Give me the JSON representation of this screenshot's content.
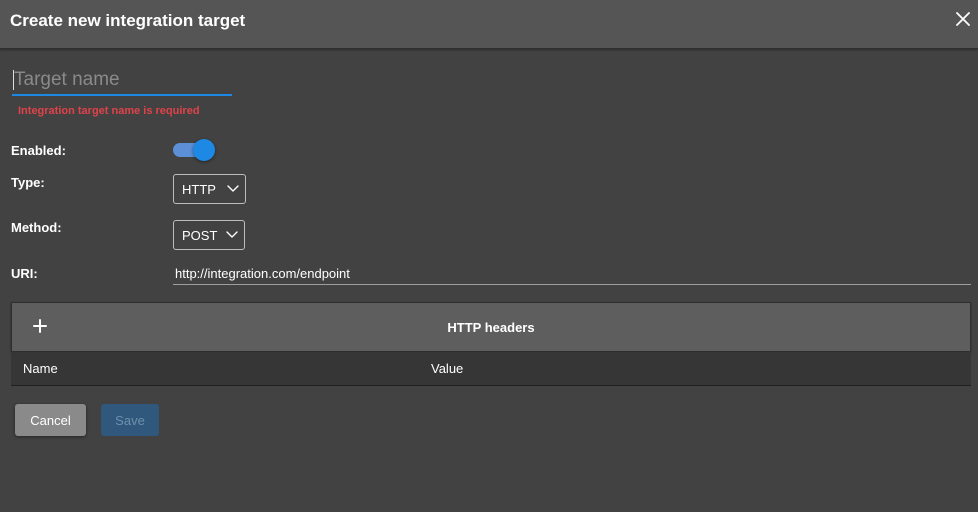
{
  "dialog": {
    "title": "Create new integration target"
  },
  "form": {
    "target_name": {
      "placeholder": "Target name",
      "value": "",
      "error": "Integration target name is required"
    },
    "enabled": {
      "label": "Enabled:",
      "on": true
    },
    "type": {
      "label": "Type:",
      "value": "HTTP"
    },
    "method": {
      "label": "Method:",
      "value": "POST"
    },
    "uri": {
      "label": "URI:",
      "value": "http://integration.com/endpoint"
    }
  },
  "headers": {
    "title": "HTTP headers",
    "columns": [
      "Name",
      "Value"
    ]
  },
  "actions": {
    "cancel_label": "Cancel",
    "save_label": "Save"
  },
  "colors": {
    "accent": "#1e88e5",
    "error": "#e0424a",
    "background": "#424242"
  },
  "icons": {
    "close": "close-icon",
    "add": "plus-icon",
    "dropdown": "chevron-down-icon"
  }
}
